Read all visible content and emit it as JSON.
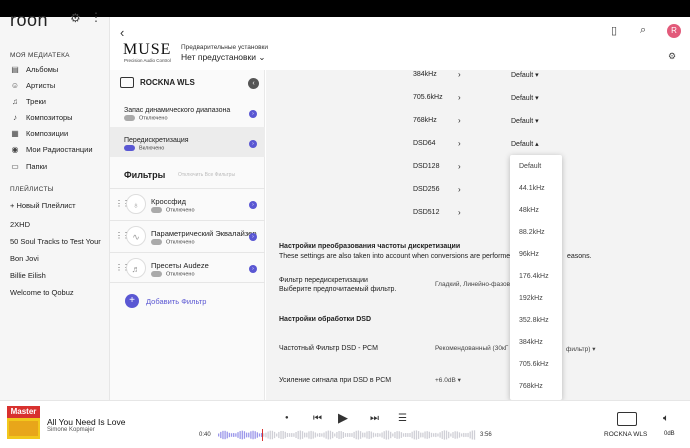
{
  "sidebar": {
    "logo": "roon",
    "library_title": "МОЯ МЕДИАТЕКА",
    "items": [
      {
        "label": "Альбомы",
        "icon": "album-icon"
      },
      {
        "label": "Артисты",
        "icon": "person-icon"
      },
      {
        "label": "Треки",
        "icon": "note-icon"
      },
      {
        "label": "Композиторы",
        "icon": "composer-icon"
      },
      {
        "label": "Композиции",
        "icon": "composition-icon"
      },
      {
        "label": "Мои Радиостанции",
        "icon": "radio-icon"
      },
      {
        "label": "Папки",
        "icon": "folder-icon"
      }
    ],
    "playlists_title": "ПЛЕЙЛИСТЫ",
    "new_playlist": "+ Новый Плейлист",
    "playlists": [
      "2XHD",
      "50 Soul Tracks to Test Your",
      "Bon Jovi",
      "Billie Eilish",
      "Welcome to Qobuz"
    ]
  },
  "header": {
    "brand": "MUSE",
    "brand_sub": "Precision Audio Control",
    "preset_label": "Предварительные установки",
    "preset_value": "Нет предустановки ⌄",
    "avatar_letter": "R"
  },
  "device": {
    "name": "ROCKNA WLS",
    "settings": [
      {
        "title": "Запас динамического диапазона",
        "state": "Отключено",
        "on": false
      },
      {
        "title": "Передискретизация",
        "state": "Включено",
        "on": true
      }
    ],
    "filters_title": "Фильтры",
    "filters_disable": "Отключить Все Фильтры",
    "filters": [
      {
        "title": "Кроссфид",
        "state": "Отключено"
      },
      {
        "title": "Параметрический Эквалайзер",
        "state": "Отключено"
      },
      {
        "title": "Пресеты Audeze",
        "state": "Отключено"
      }
    ],
    "add_filter": "Добавить Фильтр"
  },
  "rates": [
    {
      "label": "384kHz",
      "value": "Default ▾"
    },
    {
      "label": "705.6kHz",
      "value": "Default ▾"
    },
    {
      "label": "768kHz",
      "value": "Default ▾"
    },
    {
      "label": "DSD64",
      "value": "Default ▴"
    },
    {
      "label": "DSD128",
      "value": ""
    },
    {
      "label": "DSD256",
      "value": ""
    },
    {
      "label": "DSD512",
      "value": ""
    }
  ],
  "dropdown": [
    "Default",
    "44.1kHz",
    "48kHz",
    "88.2kHz",
    "96kHz",
    "176.4kHz",
    "192kHz",
    "352.8kHz",
    "384kHz",
    "705.6kHz",
    "768kHz"
  ],
  "conversion": {
    "heading": "Настройки преобразования частоты дискретизации",
    "desc": "These settings are also taken into account when conversions are performed fo",
    "desc_tail": "easons.",
    "filter_title": "Фильтр передискретизации",
    "filter_sub": "Выберите предпочитаемый фильтр.",
    "filter_value": "Гладкий, Линейно-фазовы",
    "dsd_heading": "Настройки обработки DSD",
    "dsd_filter_label": "Частотный Фильтр DSD - PCM",
    "dsd_filter_value": "Рекомендованный (30кГ",
    "dsd_filter_tail": "фильтр) ▾",
    "gain_label": "Усиление сигнала при DSD в PCM",
    "gain_value": "+6.0dB ▾"
  },
  "player": {
    "album_banner": "Master",
    "track": "All You Need Is Love",
    "artist": "Simone Kopmajer",
    "time_elapsed": "0:40",
    "time_total": "3:56",
    "zone": "ROCKNA WLS",
    "volume": "0dB",
    "progress": 0.17
  }
}
